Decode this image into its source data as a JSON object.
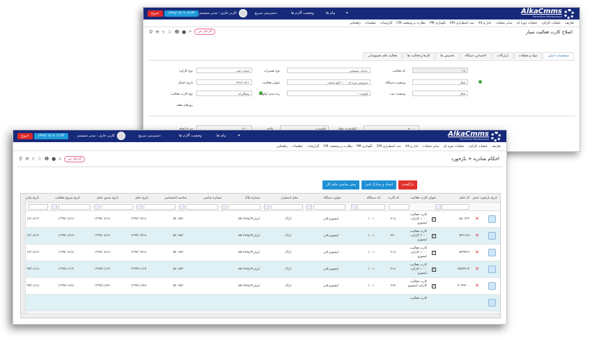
{
  "app": {
    "logo": "AlkaCmms",
    "tagline": "Preventive Maintenance",
    "exit_label": "خروج",
    "date_label": "۱۳۹۹/۰۷/۰۷ ۱۲:۳۴",
    "user_label": "کاربر جاری : مدیر سیستم",
    "quick_access": "دسترسی سریع",
    "alarm_status": "وضعیت آلارم ها",
    "messages": "پیام ها"
  },
  "menu": [
    "تعاریف",
    "عملیات کارکرد",
    "عملیات دوره ای",
    "سایر عملیات",
    "انبار و کالا",
    "EM ثبت اضطراری",
    "PM نگهداری",
    "CM نظارت بر وضعیت",
    "گزارشات",
    "تنظیمات",
    "راهنمایی"
  ],
  "back_window": {
    "title": "اصلاح کارت فعالیت سیار",
    "pill": "کارتابل من",
    "tabs": [
      "مشخصات اصلی",
      "مواد و قطعات",
      "ابزارآلات",
      "اختصاص دستگاه",
      "تخصیص ها",
      "کارها و فعالیت ها",
      "فعالیت های همپوشانی"
    ],
    "fields": {
      "work_type": "نوع کارکرد",
      "work_type_val": "انتخاب کنید",
      "repair_type": "نوع تعمیرات",
      "repair_type_val": "خدمات پشتیبانی",
      "activity_code": "کد فعالیت",
      "activity_code_val": "۱۸",
      "start_date": "تاریخ اعمال",
      "start_date_val": "۱۳۹۹/۰۸/۱۲",
      "activity_title": "عنوان فعالیت",
      "activity_title_val": "سرویس دوره ای ۱۰۰۰ کیلو ساعت",
      "device_status": "وضعیت دستگاه",
      "status_val": "فعال",
      "type": "نوع کارت فعالیت",
      "type_val": "پیشگیرانه",
      "priority": "رده بندی اولویت",
      "priority_val": "اولویت ۱",
      "status_label": "وضعیت ثبت",
      "days": "روزهای هفته",
      "cycle": "دوره انجام",
      "cycle_val": "۱۲۰۰۰",
      "unit": "واحد",
      "unit_val": "کیلومتری",
      "allowed": "کیلومتری مجاز",
      "allowed_val": "۵۰۰.۰۰",
      "check1": "زمانبندی کارکرد",
      "check2": "زمانبندی تقویمی",
      "note": "مدت زمان توقف برای انجام فعالیت",
      "note2": "توضیحات"
    }
  },
  "front_window": {
    "title": "احکام صادره + بازخورد",
    "pill": "کارتابل من",
    "btn_back": "بازگشت",
    "btn_docs": "اسناد و مدارک فنی",
    "btn_preview": "پیش نمایش حکم کار",
    "columns": [
      "تاریخ بازخورد",
      "حذف",
      "کد حکم",
      "",
      "عنوان کارت فعالیت",
      "کد کارت",
      "کد دستگاه",
      "عنوان دستگاه",
      "محل استقرار",
      "شماره پلاک",
      "شماره شاسی",
      "شناسه اختصاصی",
      "تاریخ حکم",
      "تاریخ صدور حکم",
      "تاریخ شروع فعالیت",
      "تاریخ پایان"
    ],
    "rows": [
      {
        "code": "۵۸۰۳۳۲",
        "card": "کارت فعالیت ۱۰۰۰ کارکرد ایسوزو",
        "cc": "۲۱۸",
        "dc": "۱۰۰۱",
        "dev": "ایسوزو ۵تن",
        "loc": "اراک",
        "plate": "ایران۶۴ع۶۷۷-۵۵",
        "ch": "",
        "sid": "۵۲۰۶۵۳",
        "d1": "۱۳۹۹/۰۹/۱۸",
        "d2": "۱۳۹۹/۰۸/۱۷",
        "d3": "۱۳۹۹/۰۸/۱۷",
        "d4": "۱۴/۰۸/۱۳"
      },
      {
        "code": "۵۳۳۱۸۹",
        "card": "کارت فعالیت ۳۰۰۰ کارکرد ایسوزو",
        "cc": "۲۴۰",
        "dc": "۱۰۰۱",
        "dev": "ایسوزو ۵تن",
        "loc": "اراک",
        "plate": "ایران۶۴ع۶۷۷-۵۵",
        "ch": "",
        "sid": "۵۲۰۶۵۳",
        "d1": "۱۳۹۹/۰۹/۱۸",
        "d2": "۱۳۹۹/۰۸/۱۷",
        "d3": "۱۳۹۹/۰۸/۱۷",
        "d4": "۱۴/۰۸/۱۳"
      },
      {
        "code": "۵۳۹۳۳۷",
        "card": "کارت فعالیت ۱۰۰۰ کارکرد ایسوزو",
        "cc": "۲۱۸",
        "dc": "۱۰۰۱",
        "dev": "ایسوزو ۵تن",
        "loc": "اراک",
        "plate": "ایران۶۴ع۶۷۷-۵۵",
        "ch": "",
        "sid": "۵۲۰۶۵۳",
        "d1": "۱۳۹۹/۰۹/۱۸",
        "d2": "۱۳۹۹/۰۸/۱۷",
        "d3": "۱۳۹۹/۰۸/۱۷",
        "d4": "۱۴/۰۸/۱۳"
      },
      {
        "code": "۴۵۶۴۲۱۴",
        "card": "کارت فعالیت ۱۰۰۰ کارکرد ایسوزو",
        "cc": "۲۱۸",
        "dc": "۱۰۰۱",
        "dev": "ایسوزو ۵تن",
        "loc": "اراک",
        "plate": "ایران۶۴ع۶۷۷-۵۵",
        "ch": "",
        "sid": "۵۲۰۶۵۳",
        "d1": "۱۳۹۹/۱۱/۱۴",
        "d2": "۱۳۹۹/۱۱/۱۴",
        "d3": "۱۳۹۹/۱۱/۱۴",
        "d4": "۹۹/۱۱/۱۸"
      },
      {
        "code": "۴۰۹۹۳۰۰",
        "card": "کارت فعالیت کارکرد ایسوزو",
        "cc": "۲۶۲",
        "dc": "۱۰۰۱",
        "dev": "ایسوزو ۵تن",
        "loc": "اراک",
        "plate": "ایران۶۴ع۶۷۷-۵۵",
        "ch": "",
        "sid": "۵۲۰۶۵۳",
        "d1": "۱۳۹۹/۱۱/۲۷",
        "d2": "۱۳۹۹/۱۱/۲۷",
        "d3": "۱۳۹۹/۱۱/۲۷",
        "d4": "۹۹/۱۱/۱۸"
      },
      {
        "code": "",
        "card": "کارت فعالیت",
        "cc": "",
        "dc": "",
        "dev": "",
        "loc": "",
        "plate": "",
        "ch": "",
        "sid": "",
        "d1": "",
        "d2": "",
        "d3": "",
        "d4": ""
      }
    ]
  },
  "colors": {
    "topbar": "#172a7a",
    "red": "#e0302b",
    "blue": "#1e8fd4",
    "row_alt": "#dff1f5"
  }
}
